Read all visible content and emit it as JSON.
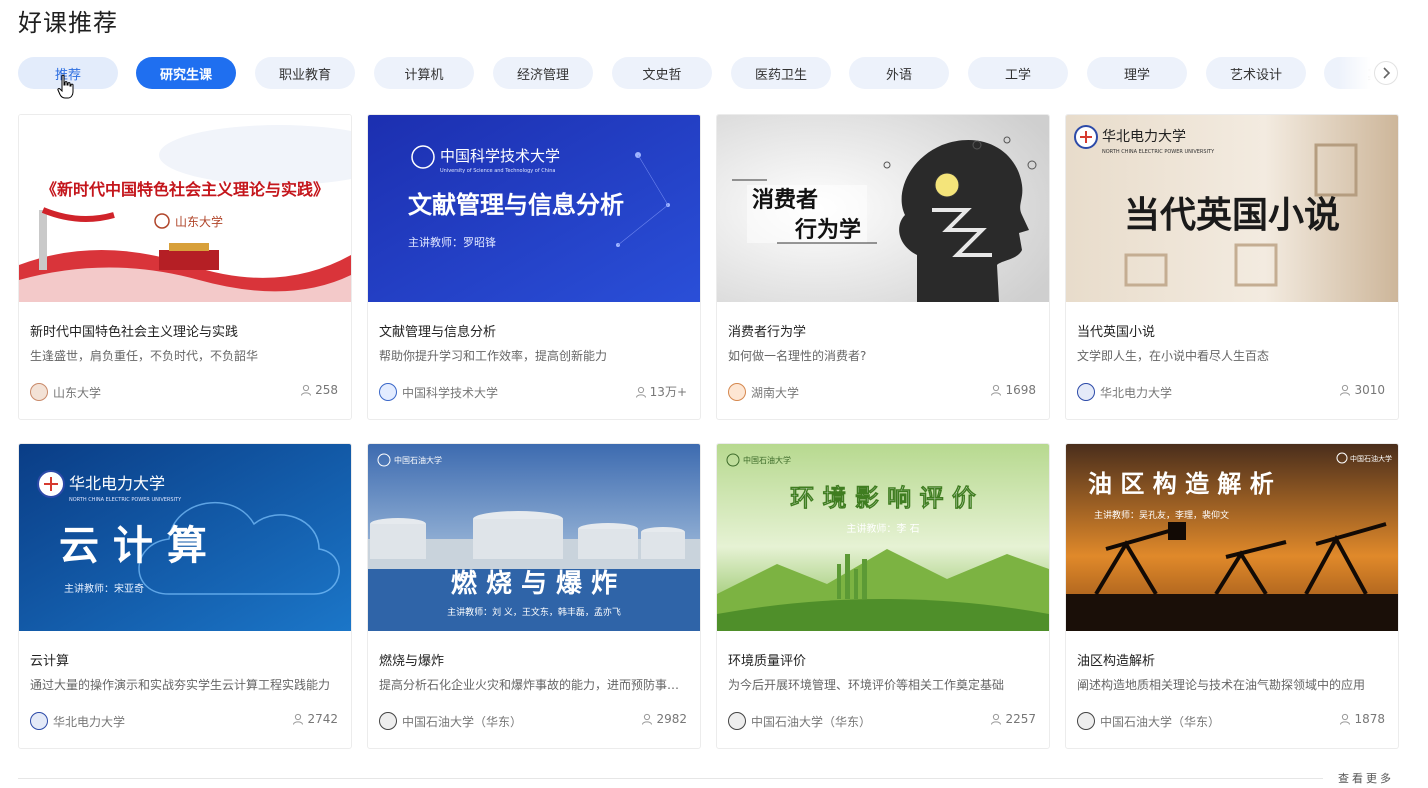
{
  "page_title": "好课推荐",
  "tabs": [
    {
      "label": "推荐",
      "state": "hover"
    },
    {
      "label": "研究生课",
      "state": "active"
    },
    {
      "label": "职业教育",
      "state": "normal"
    },
    {
      "label": "计算机",
      "state": "normal"
    },
    {
      "label": "经济管理",
      "state": "normal"
    },
    {
      "label": "文史哲",
      "state": "normal"
    },
    {
      "label": "医药卫生",
      "state": "normal"
    },
    {
      "label": "外语",
      "state": "normal"
    },
    {
      "label": "工学",
      "state": "normal"
    },
    {
      "label": "理学",
      "state": "normal"
    },
    {
      "label": "艺术设计",
      "state": "normal"
    },
    {
      "label": "其",
      "state": "normal"
    }
  ],
  "courses": [
    {
      "title": "新时代中国特色社会主义理论与实践",
      "desc": "生逢盛世，肩负重任，不负时代，不负韶华",
      "university": "山东大学",
      "count": "258",
      "thumb": {
        "text": "《新时代中国特色社会主义理论与实践》",
        "sub": "山东大学",
        "logo": "山东大学"
      }
    },
    {
      "title": "文献管理与信息分析",
      "desc": "帮助你提升学习和工作效率，提高创新能力",
      "university": "中国科学技术大学",
      "count": "13万+",
      "thumb": {
        "text": "文献管理与信息分析",
        "sub": "主讲教师：罗昭锋",
        "logo": "中国科学技术大学",
        "logo_en": "University of Science and Technology of China"
      }
    },
    {
      "title": "消费者行为学",
      "desc": "如何做一名理性的消费者?",
      "university": "湖南大学",
      "count": "1698",
      "thumb": {
        "text": "消费者",
        "text2": "行为学"
      }
    },
    {
      "title": "当代英国小说",
      "desc": "文学即人生，在小说中看尽人生百态",
      "university": "华北电力大学",
      "count": "3010",
      "thumb": {
        "text": "当代英国小说",
        "logo": "华北电力大学",
        "logo_en": "NORTH CHINA ELECTRIC POWER UNIVERSITY"
      }
    },
    {
      "title": "云计算",
      "desc": "通过大量的操作演示和实战夯实学生云计算工程实践能力",
      "university": "华北电力大学",
      "count": "2742",
      "thumb": {
        "text": "云 计 算",
        "sub": "主讲教师：宋亚奇",
        "logo": "华北电力大学",
        "logo_en": "NORTH CHINA ELECTRIC POWER UNIVERSITY"
      }
    },
    {
      "title": "燃烧与爆炸",
      "desc": "提高分析石化企业火灾和爆炸事故的能力，进而预防事故发生",
      "university": "中国石油大学（华东）",
      "count": "2982",
      "thumb": {
        "text": "燃 烧 与 爆 炸",
        "sub": "主讲教师：刘  义，王文东，韩丰磊，孟亦飞",
        "logo": "中国石油大学"
      }
    },
    {
      "title": "环境质量评价",
      "desc": "为今后开展环境管理、环境评价等相关工作奠定基础",
      "university": "中国石油大学（华东）",
      "count": "2257",
      "thumb": {
        "text": "环 境 影 响 评 价",
        "sub": "主讲教师：李 石",
        "logo": "中国石油大学"
      }
    },
    {
      "title": "油区构造解析",
      "desc": "阐述构造地质相关理论与技术在油气勘探领域中的应用",
      "university": "中国石油大学（华东）",
      "count": "1878",
      "thumb": {
        "text": "油 区 构 造 解 析",
        "sub": "主讲教师：吴孔友，李理，裴仰文",
        "logo": "中国石油大学"
      }
    }
  ],
  "more_link": "查看更多"
}
